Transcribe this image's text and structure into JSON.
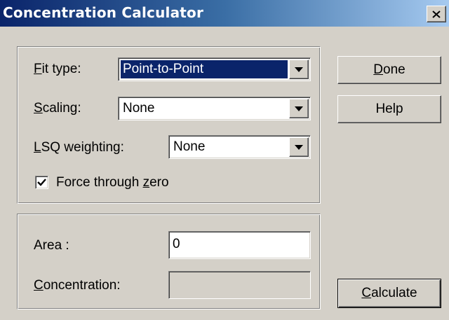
{
  "window": {
    "title": "Concentration Calculator",
    "close_glyph": "close-icon"
  },
  "settings": {
    "fit_type": {
      "accel": "F",
      "label_rest": "it type:",
      "value": "Point-to-Point"
    },
    "scaling": {
      "accel": "S",
      "label_rest": "caling:",
      "value": "None"
    },
    "lsq_weighting": {
      "accel": "L",
      "label_rest": "SQ weighting:",
      "value": "None"
    },
    "force_zero": {
      "label_pre": "Force through ",
      "accel": "z",
      "label_rest": "ero",
      "checked": true
    }
  },
  "calculation": {
    "area": {
      "label": "Area :",
      "value": "0"
    },
    "concentration": {
      "accel": "C",
      "label_rest": "oncentration:",
      "value": ""
    }
  },
  "buttons": {
    "done": {
      "accel": "D",
      "label_rest": "one"
    },
    "help": {
      "label": "Help"
    },
    "calculate": {
      "accel": "C",
      "label_rest": "alculate"
    }
  },
  "colors": {
    "dialog_bg": "#d4d0c8",
    "title_start": "#0a246a",
    "title_end": "#a6caf0",
    "selection": "#0a246a"
  }
}
